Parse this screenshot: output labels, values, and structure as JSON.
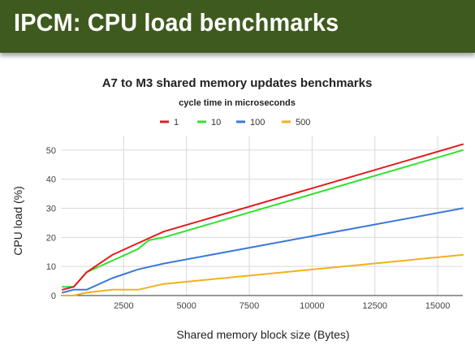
{
  "slide": {
    "title": "IPCM: CPU load benchmarks"
  },
  "chart_data": {
    "type": "line",
    "title": "A7 to M3 shared memory updates benchmarks",
    "subtitle": "cycle time in microseconds",
    "xlabel": "Shared memory block size (Bytes)",
    "ylabel": "CPU load (%)",
    "xlim": [
      0,
      16000
    ],
    "ylim": [
      0,
      55
    ],
    "xticks": [
      2500,
      5000,
      7500,
      10000,
      12500,
      15000
    ],
    "yticks": [
      0,
      10,
      20,
      30,
      40,
      50
    ],
    "grid": "vertical and horizontal",
    "legend_position": "top",
    "series": [
      {
        "name": "1",
        "color": "#e31a1c",
        "x": [
          64,
          512,
          1024,
          2048,
          3072,
          4096,
          16000
        ],
        "y": [
          2,
          3,
          8,
          14,
          18,
          22,
          52
        ]
      },
      {
        "name": "10",
        "color": "#33e02f",
        "x": [
          64,
          512,
          1024,
          2048,
          3072,
          3500,
          4096,
          16000
        ],
        "y": [
          3,
          3,
          8,
          12,
          16,
          19,
          20,
          50
        ]
      },
      {
        "name": "100",
        "color": "#3c78d8",
        "x": [
          64,
          512,
          1024,
          2048,
          3072,
          4096,
          16000
        ],
        "y": [
          1,
          2,
          2,
          6,
          9,
          11,
          30
        ]
      },
      {
        "name": "500",
        "color": "#f2b01e",
        "x": [
          64,
          512,
          1024,
          2048,
          3072,
          4096,
          16000
        ],
        "y": [
          0,
          0,
          1,
          2,
          2,
          4,
          14
        ]
      }
    ]
  }
}
